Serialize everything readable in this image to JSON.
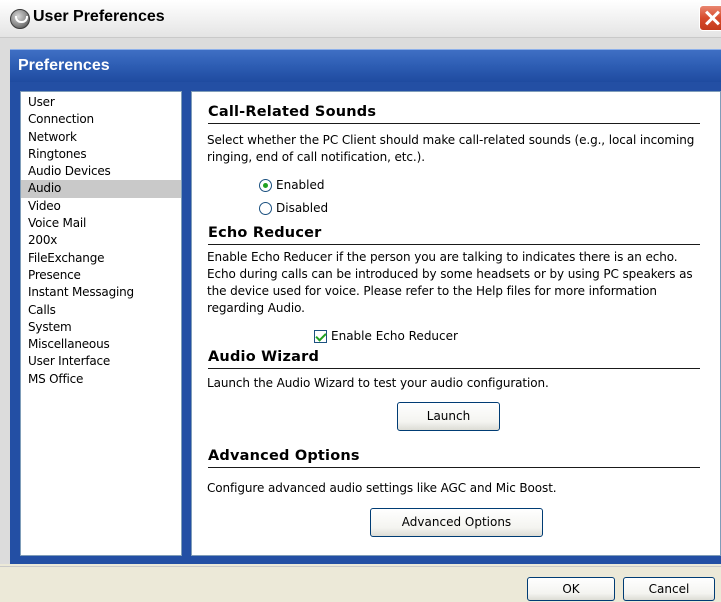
{
  "window": {
    "title": "User Preferences"
  },
  "header": {
    "title": "Preferences"
  },
  "sidebar": {
    "items": [
      {
        "label": "User"
      },
      {
        "label": "Connection"
      },
      {
        "label": "Network"
      },
      {
        "label": "Ringtones"
      },
      {
        "label": "Audio Devices"
      },
      {
        "label": "Audio"
      },
      {
        "label": "Video"
      },
      {
        "label": "Voice Mail"
      },
      {
        "label": "200x"
      },
      {
        "label": "FileExchange"
      },
      {
        "label": "Presence"
      },
      {
        "label": "Instant Messaging"
      },
      {
        "label": "Calls"
      },
      {
        "label": "System"
      },
      {
        "label": "Miscellaneous"
      },
      {
        "label": "User Interface"
      },
      {
        "label": "MS Office"
      }
    ],
    "selected": "Audio"
  },
  "call_sounds": {
    "title": "Call-Related Sounds",
    "description": "Select whether the PC Client should make call-related sounds (e.g., local incoming ringing, end of call notification, etc.).",
    "options": [
      {
        "label": "Enabled",
        "selected": true
      },
      {
        "label": "Disabled",
        "selected": false
      }
    ]
  },
  "echo_reducer": {
    "title": "Echo Reducer",
    "description": "Enable Echo Reducer if the person you are talking to indicates there is an echo. Echo during calls can be introduced by some headsets or by using PC speakers as the device used for voice. Please refer to the Help files for more information regarding Audio.",
    "checkbox_label": "Enable Echo Reducer",
    "checked": true
  },
  "audio_wizard": {
    "title": "Audio Wizard",
    "description": "Launch the Audio Wizard to test your audio configuration.",
    "button_label": "Launch"
  },
  "advanced": {
    "title": "Advanced Options",
    "description": "Configure advanced audio settings like AGC and Mic Boost.",
    "button_label": "Advanced Options"
  },
  "footer": {
    "ok_label": "OK",
    "cancel_label": "Cancel"
  },
  "colors": {
    "header_blue": "#2d5db3",
    "selection_gray": "#c9c9c9",
    "check_green": "#21a121",
    "close_red": "#d74b2c"
  },
  "icons": {
    "app": "app-logo-icon",
    "close": "close-icon"
  }
}
